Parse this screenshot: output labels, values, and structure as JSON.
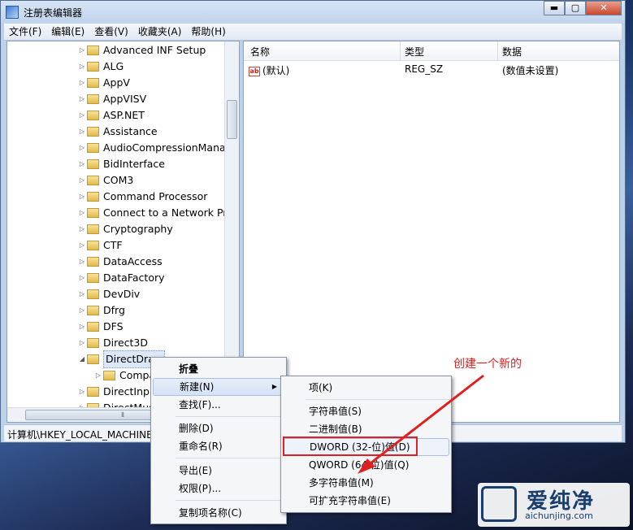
{
  "window": {
    "title": "注册表编辑器",
    "buttons": {
      "minimize": "▬",
      "maximize": "▢",
      "close": "✕"
    }
  },
  "menubar": [
    "文件(F)",
    "编辑(E)",
    "查看(V)",
    "收藏夹(A)",
    "帮助(H)"
  ],
  "tree": {
    "items": [
      {
        "label": "Advanced INF Setup",
        "arrow": "▷"
      },
      {
        "label": "ALG",
        "arrow": "▷"
      },
      {
        "label": "AppV",
        "arrow": "▷"
      },
      {
        "label": "AppVISV",
        "arrow": "▷"
      },
      {
        "label": "ASP.NET",
        "arrow": "▷"
      },
      {
        "label": "Assistance",
        "arrow": "▷"
      },
      {
        "label": "AudioCompressionManag",
        "arrow": "▷"
      },
      {
        "label": "BidInterface",
        "arrow": "▷"
      },
      {
        "label": "COM3",
        "arrow": "▷"
      },
      {
        "label": "Command Processor",
        "arrow": "▷"
      },
      {
        "label": "Connect to a Network Pro",
        "arrow": "▷"
      },
      {
        "label": "Cryptography",
        "arrow": "▷"
      },
      {
        "label": "CTF",
        "arrow": "▷"
      },
      {
        "label": "DataAccess",
        "arrow": "▷"
      },
      {
        "label": "DataFactory",
        "arrow": "▷"
      },
      {
        "label": "DevDiv",
        "arrow": "▷"
      },
      {
        "label": "Dfrg",
        "arrow": "▷"
      },
      {
        "label": "DFS",
        "arrow": "▷"
      },
      {
        "label": "Direct3D",
        "arrow": "▷"
      },
      {
        "label": "DirectDraw",
        "arrow": "◢"
      },
      {
        "label": "Compa",
        "arrow": "▷"
      },
      {
        "label": "DirectInput",
        "arrow": "▷"
      },
      {
        "label": "DirectMusic",
        "arrow": "▷"
      }
    ]
  },
  "list": {
    "columns": [
      "名称",
      "类型",
      "数据"
    ],
    "rows": [
      {
        "icon": "ab",
        "name": "(默认)",
        "type": "REG_SZ",
        "data": "(数值未设置)"
      }
    ]
  },
  "statusbar": {
    "path": "计算机\\HKEY_LOCAL_MACHINE\\SOFTWARE\\Microsoft\\DirectDraw"
  },
  "context_menu": {
    "items": [
      {
        "label": "折叠"
      },
      {
        "label": "新建(N)",
        "submenu_arrow": "▶"
      },
      {
        "label": "查找(F)..."
      },
      {
        "label": "删除(D)"
      },
      {
        "label": "重命名(R)"
      },
      {
        "label": "导出(E)"
      },
      {
        "label": "权限(P)..."
      },
      {
        "label": "复制项名称(C)"
      }
    ]
  },
  "submenu": {
    "items": [
      {
        "label": "项(K)"
      },
      {
        "label": "字符串值(S)"
      },
      {
        "label": "二进制值(B)"
      },
      {
        "label": "DWORD (32-位)值(D)"
      },
      {
        "label": "QWORD (64 位)值(Q)"
      },
      {
        "label": "多字符串值(M)"
      },
      {
        "label": "可扩充字符串值(E)"
      }
    ]
  },
  "annotation": {
    "text": "创建一个新的",
    "color": "#e02020"
  },
  "watermark": {
    "brand": "爱纯净",
    "url": "aichunjing.com"
  }
}
